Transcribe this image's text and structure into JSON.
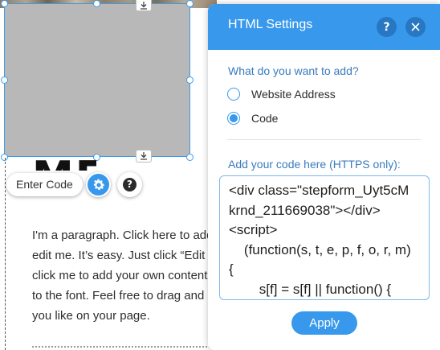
{
  "canvas": {
    "enter_code_label": "Enter Code",
    "title_fragment": "ME",
    "paragraph_lines": [
      "I'm a paragraph. Click here to add your own text and",
      "edit me. It’s easy. Just click “Edit Text” or double",
      "click me to add your own content and make changes",
      "to the font. Feel free to drag and drop me anywhere",
      "you like on your page."
    ]
  },
  "panel": {
    "title": "HTML Settings",
    "help_glyph": "?",
    "what_label": "What do you want to add?",
    "options": [
      {
        "label": "Website Address",
        "selected": false
      },
      {
        "label": "Code",
        "selected": true
      }
    ],
    "code_label": "Add your code here (HTTPS only):",
    "code_value": "<div class=\"stepform_Uyt5cMkrnd_211669038\"></div>\n<script>\n    (function(s, t, e, p, f, o, r, m) {\n        s[f] = s[f] || function() {",
    "apply_label": "Apply"
  },
  "colors": {
    "accent": "#3899ec",
    "header_button": "#2877c2",
    "section_label": "#3a7cbf",
    "selection_outline": "#3d9be9",
    "placeholder_box": "#b8b8b8"
  },
  "icons": [
    "download-icon",
    "gear-icon",
    "help-icon",
    "close-icon",
    "help-circle-icon"
  ]
}
